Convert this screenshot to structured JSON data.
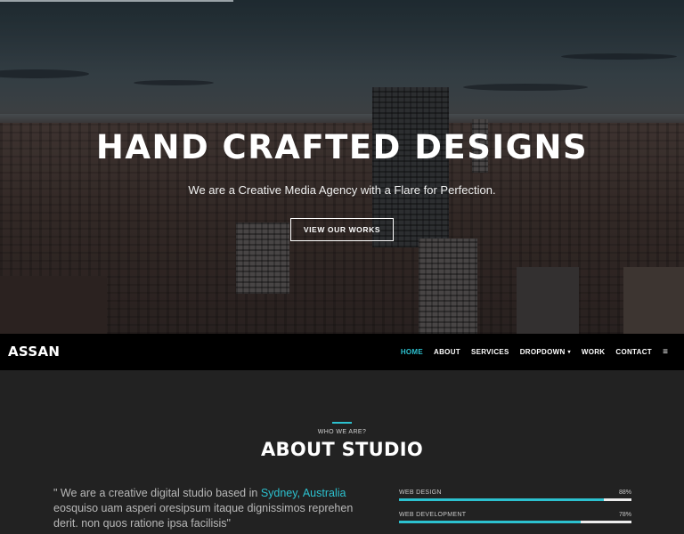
{
  "hero": {
    "title": "HAND CRAFTED DESIGNS",
    "subtitle": "We are a Creative Media Agency with a Flare for Perfection.",
    "cta_label": "VIEW OUR WORKS"
  },
  "nav": {
    "logo": "ASSAN",
    "items": [
      {
        "label": "HOME",
        "active": true
      },
      {
        "label": "ABOUT"
      },
      {
        "label": "SERVICES"
      },
      {
        "label": "DROPDOWN",
        "caret": "▾"
      },
      {
        "label": "WORK"
      },
      {
        "label": "CONTACT"
      }
    ],
    "menu_icon": "≡"
  },
  "about": {
    "eyebrow": "WHO WE ARE?",
    "title": "ABOUT STUDIO",
    "quote_before": "\" We are a creative digital studio based in ",
    "quote_highlight": "Sydney, Australia",
    "quote_after": " eosquiso uam asperi oresipsum itaque dignissimos reprehen derit. non quos ratione ipsa facilisis\"",
    "skills": [
      {
        "name": "WEB DESIGN",
        "percent_label": "88%",
        "value": 88
      },
      {
        "name": "WEB DEVELOPMENT",
        "percent_label": "78%",
        "value": 78
      }
    ]
  },
  "colors": {
    "accent": "#2cc1cf",
    "navbar_bg": "#000000",
    "section_bg": "#222222"
  }
}
